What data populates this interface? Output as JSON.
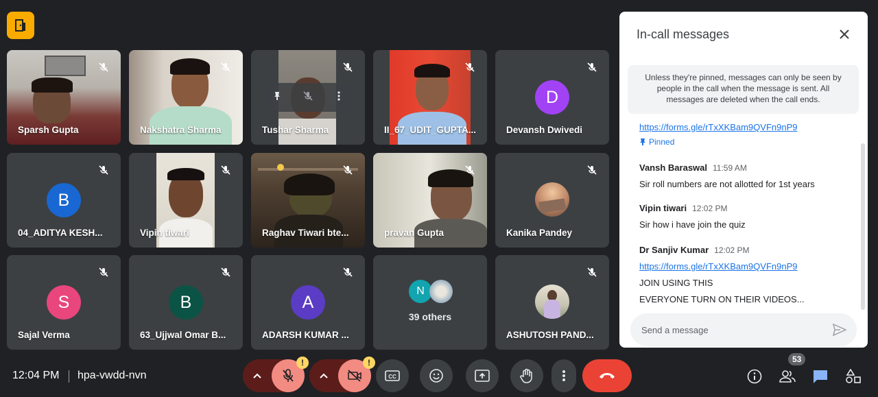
{
  "app": {
    "logo_icon": "door-exit-icon"
  },
  "participants": [
    {
      "name": "Sparsh Gupta",
      "type": "video",
      "muted": true
    },
    {
      "name": "Nakshatra Sharma",
      "type": "video",
      "muted": true
    },
    {
      "name": "Tushar Sharma",
      "type": "video",
      "muted": true,
      "hover_controls": true
    },
    {
      "name": "II_67_UDIT_GUPTA...",
      "type": "video",
      "muted": true
    },
    {
      "name": "Devansh Dwivedi",
      "type": "letter",
      "letter": "D",
      "color": "#a142f4",
      "muted": true
    },
    {
      "name": "04_ADITYA KESH...",
      "type": "letter",
      "letter": "B",
      "color": "#1967d2",
      "muted": true
    },
    {
      "name": "Vipin tiwari",
      "type": "video",
      "muted": true
    },
    {
      "name": "Raghav Tiwari bte...",
      "type": "video",
      "muted": true
    },
    {
      "name": "pravan Gupta",
      "type": "video",
      "muted": true
    },
    {
      "name": "Kanika Pandey",
      "type": "photo",
      "muted": true
    },
    {
      "name": "Sajal Verma",
      "type": "letter",
      "letter": "S",
      "color": "#e8467c",
      "muted": true
    },
    {
      "name": "63_Ujjwal Omar B...",
      "type": "letter",
      "letter": "B",
      "color": "#0b5345",
      "muted": true
    },
    {
      "name": "ADARSH KUMAR ...",
      "type": "letter",
      "letter": "A",
      "color": "#5b3cc4",
      "muted": true
    },
    {
      "name": "ASHUTOSH PAND...",
      "type": "photo",
      "muted": true
    }
  ],
  "others": {
    "label": "39 others",
    "avatar_letter": "N",
    "avatar_color": "#12a4af"
  },
  "bottom_bar": {
    "time": "12:04 PM",
    "meeting_code": "hpa-vwdd-nvn",
    "warn_symbol": "!",
    "participant_count": "53"
  },
  "chat": {
    "title": "In-call messages",
    "notice": "Unless they're pinned, messages can only be seen by people in the call when the message is sent. All messages are deleted when the call ends.",
    "pinned_link": "https://forms.gle/rTxXKBam9QVFn9nP9",
    "pinned_label": "Pinned",
    "messages": [
      {
        "sender": "Vansh Baraswal",
        "time": "11:59 AM",
        "lines": [
          "Sir roll numbers are not allotted for 1st years"
        ]
      },
      {
        "sender": "Vipin tiwari",
        "time": "12:02 PM",
        "lines": [
          "Sir how i have join the quiz"
        ]
      },
      {
        "sender": "Dr Sanjiv Kumar",
        "time": "12:02 PM",
        "link": "https://forms.gle/rTxXKBam9QVFn9nP9",
        "lines": [
          "JOIN USING THIS",
          "EVERYONE TURN ON THEIR VIDEOS..."
        ]
      }
    ],
    "input_placeholder": "Send a message"
  }
}
